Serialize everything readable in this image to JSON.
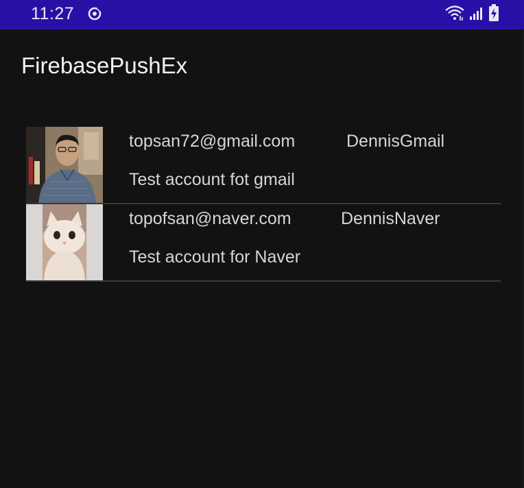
{
  "status_bar": {
    "time": "11:27",
    "color": "#2a0fa6",
    "icons": [
      "sync-icon",
      "wifi-icon",
      "signal-icon",
      "battery-charging-icon"
    ]
  },
  "app": {
    "title": "FirebasePushEx"
  },
  "accounts": [
    {
      "email": "topsan72@gmail.com",
      "name": "DennisGmail",
      "description": "Test account fot gmail",
      "avatar": "person-photo"
    },
    {
      "email": "topofsan@naver.com",
      "name": "DennisNaver",
      "description": "Test account for Naver",
      "avatar": "cat-photo"
    }
  ]
}
